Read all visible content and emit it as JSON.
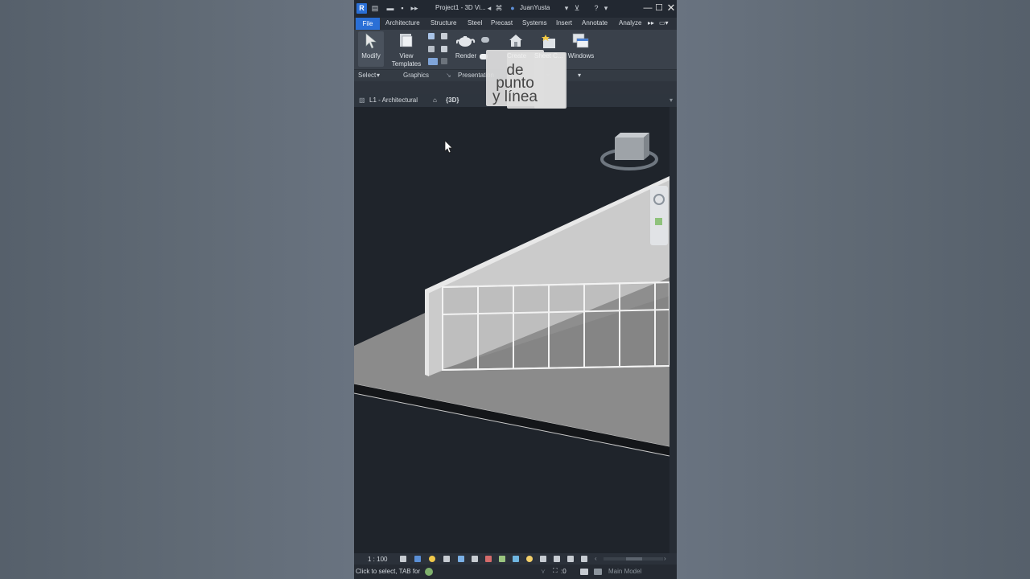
{
  "title_bar": {
    "app_logo": "R",
    "project_title": "Project1 - 3D Vi...",
    "user": "JuanYusta",
    "icons": [
      "save-icon",
      "open-icon",
      "undo-icon",
      "user-icon",
      "cart-icon",
      "help-icon"
    ]
  },
  "window_controls": {
    "minimize": "—",
    "maximize": "☐",
    "close": "✕"
  },
  "ribbon_tabs": [
    "File",
    "Architecture",
    "Structure",
    "Steel",
    "Precast",
    "Systems",
    "Insert",
    "Annotate",
    "Analyze"
  ],
  "ribbon": {
    "modify_label": "Modify",
    "view_templates_label_1": "View",
    "view_templates_label_2": "Templates",
    "render_label": "Render",
    "create_label": "Create",
    "sheet_label": "Sheet C...",
    "windows_label": "Windows"
  },
  "panels": {
    "select": "Select",
    "graphics": "Graphics",
    "presentation": "Presentation"
  },
  "overlay": {
    "line1": "de",
    "line2": "punto",
    "line3": "y línea"
  },
  "view_tabs": [
    {
      "label": "L1 - Architectural"
    },
    {
      "label": "{3D}"
    }
  ],
  "status": {
    "scale": "1 : 100",
    "hint": "Click to select, TAB for",
    "selection_count": ":0",
    "model": "Main Model"
  },
  "colors": {
    "accent": "#2a6fd6",
    "background": "#1f242b",
    "wall": "#c9c9c9",
    "floor": "#8a8a8a"
  }
}
